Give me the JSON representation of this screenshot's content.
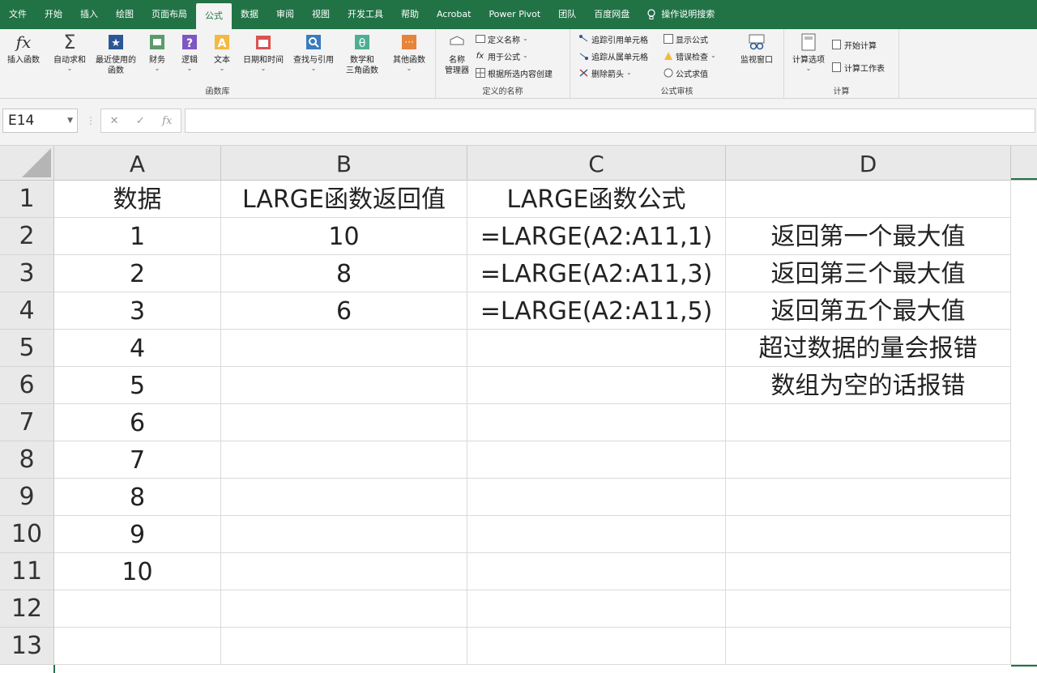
{
  "tabs": [
    {
      "label": "文件"
    },
    {
      "label": "开始"
    },
    {
      "label": "插入"
    },
    {
      "label": "绘图"
    },
    {
      "label": "页面布局"
    },
    {
      "label": "公式"
    },
    {
      "label": "数据"
    },
    {
      "label": "审阅"
    },
    {
      "label": "视图"
    },
    {
      "label": "开发工具"
    },
    {
      "label": "帮助"
    },
    {
      "label": "Acrobat"
    },
    {
      "label": "Power Pivot"
    },
    {
      "label": "团队"
    },
    {
      "label": "百度网盘"
    }
  ],
  "active_tab": "公式",
  "tell_me": "操作说明搜索",
  "ribbon": {
    "function_library": {
      "label": "函数库",
      "insert_function": "插入函数",
      "autosum": "自动求和",
      "recent": "最近使用的",
      "recent2": "函数",
      "financial": "财务",
      "logical": "逻辑",
      "text": "文本",
      "datetime": "日期和时间",
      "lookup": "查找与引用",
      "math": "数学和",
      "math2": "三角函数",
      "more": "其他函数"
    },
    "defined_names": {
      "label": "定义的名称",
      "name_manager": "名称",
      "name_manager2": "管理器",
      "define_name": "定义名称",
      "use_in_formula": "用于公式",
      "create_from_selection": "根据所选内容创建"
    },
    "formula_auditing": {
      "label": "公式审核",
      "trace_precedents": "追踪引用单元格",
      "trace_dependents": "追踪从属单元格",
      "remove_arrows": "删除箭头",
      "show_formulas": "显示公式",
      "error_checking": "错误检查",
      "evaluate_formula": "公式求值",
      "watch_window": "监视窗口"
    },
    "calculation": {
      "label": "计算",
      "options": "计算选项",
      "calc_now": "开始计算",
      "calc_sheet": "计算工作表"
    }
  },
  "formula_bar": {
    "name_box": "E14",
    "formula": ""
  },
  "columns": [
    "A",
    "B",
    "C",
    "D"
  ],
  "rows": [
    "1",
    "2",
    "3",
    "4",
    "5",
    "6",
    "7",
    "8",
    "9",
    "10",
    "11",
    "12",
    "13"
  ],
  "cells": {
    "A": [
      "数据",
      "1",
      "2",
      "3",
      "4",
      "5",
      "6",
      "7",
      "8",
      "9",
      "10",
      "",
      ""
    ],
    "B": [
      "LARGE函数返回值",
      "10",
      "8",
      "6",
      "",
      "",
      "",
      "",
      "",
      "",
      "",
      "",
      ""
    ],
    "C": [
      "LARGE函数公式",
      "=LARGE(A2:A11,1)",
      "=LARGE(A2:A11,3)",
      "=LARGE(A2:A11,5)",
      "",
      "",
      "",
      "",
      "",
      "",
      "",
      "",
      ""
    ],
    "D": [
      "",
      "返回第一个最大值",
      "返回第三个最大值",
      "返回第五个最大值",
      "超过数据的量会报错",
      "数组为空的话报错",
      "",
      "",
      "",
      "",
      "",
      "",
      ""
    ]
  },
  "colors": {
    "accent": "#217346",
    "ribbon_bg": "#f3f3f3",
    "header_bg": "#e9e9e9"
  }
}
